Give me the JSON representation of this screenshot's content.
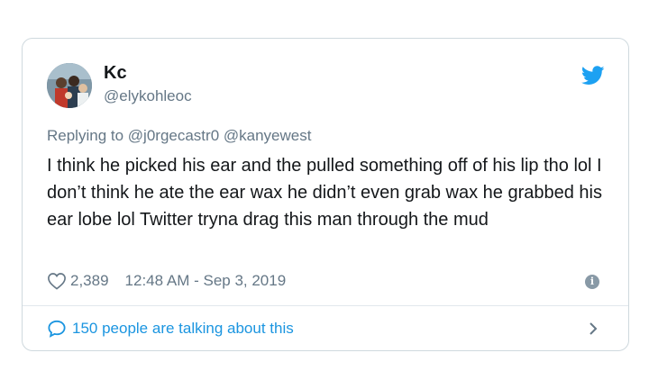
{
  "tweet": {
    "author_name": "Kc",
    "author_handle": "@elykohleoc",
    "replying_prefix": "Replying to",
    "replying_mentions": "@j0rgecastr0 @kanyewest",
    "text": "I think he picked his ear and the pulled something off of his lip tho lol I don’t think he ate the ear wax he didn’t even grab wax he grabbed his ear lobe lol Twitter tryna drag this man through the mud",
    "likes": "2,389",
    "timestamp": "12:48 AM - Sep 3, 2019",
    "talking": "150 people are talking about this"
  },
  "icons": {
    "bird": "twitter-bird-icon",
    "heart": "heart-icon",
    "info": "info-icon",
    "bubble": "speech-bubble-icon",
    "chevron": "chevron-right-icon"
  },
  "colors": {
    "twitter_blue": "#1da1f2",
    "link_blue": "#1b95e0",
    "secondary_text": "#657786",
    "primary_text": "#14171a",
    "border": "#cfd9de"
  }
}
